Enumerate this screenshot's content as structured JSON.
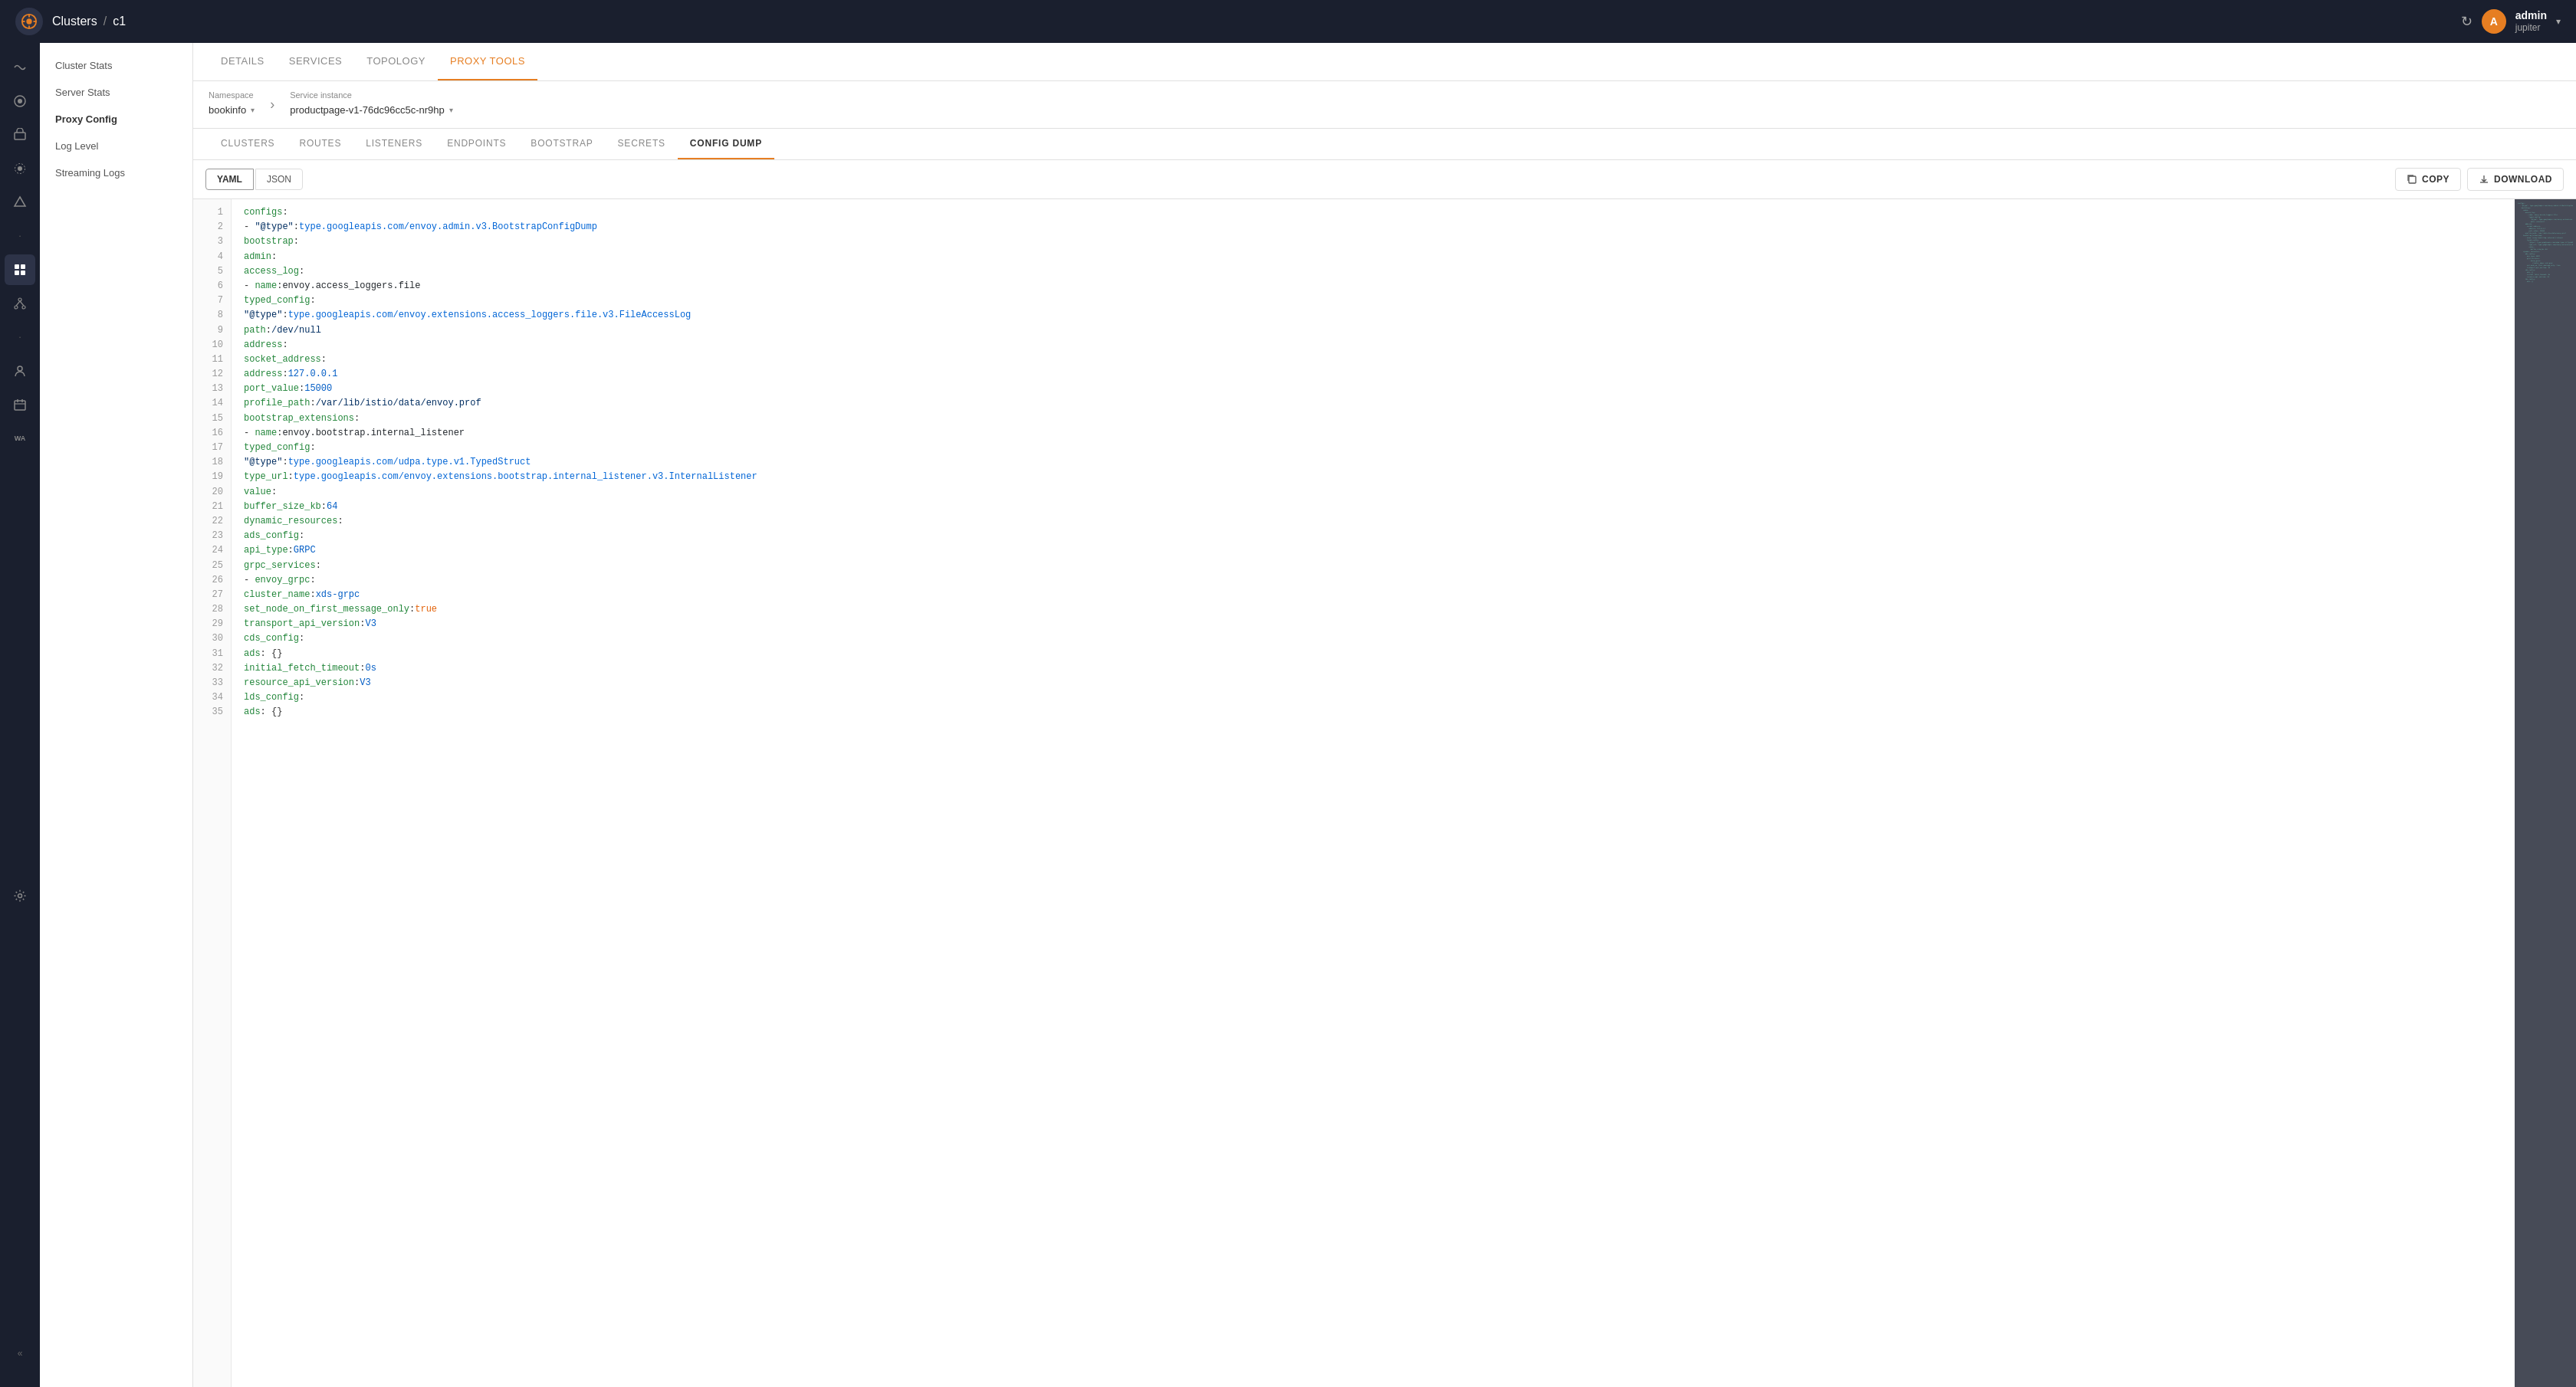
{
  "app": {
    "logo_alt": "Kiali",
    "breadcrumb": {
      "parent": "Clusters",
      "separator": "/",
      "current": "c1"
    }
  },
  "user": {
    "initial": "A",
    "name": "admin",
    "org": "jupiter"
  },
  "top_tabs": [
    {
      "id": "details",
      "label": "DETAILS"
    },
    {
      "id": "services",
      "label": "SERVICES"
    },
    {
      "id": "topology",
      "label": "TOPOLOGY"
    },
    {
      "id": "proxy-tools",
      "label": "PROXY TOOLS",
      "active": true
    }
  ],
  "namespace": {
    "label": "Namespace",
    "value": "bookinfo"
  },
  "service_instance": {
    "label": "Service instance",
    "value": "productpage-v1-76dc96cc5c-nr9hp"
  },
  "proxy_tabs": [
    {
      "id": "clusters",
      "label": "CLUSTERS"
    },
    {
      "id": "routes",
      "label": "ROUTES"
    },
    {
      "id": "listeners",
      "label": "LISTENERS"
    },
    {
      "id": "endpoints",
      "label": "ENDPOINTS"
    },
    {
      "id": "bootstrap",
      "label": "BOOTSTRAP"
    },
    {
      "id": "secrets",
      "label": "SECRETS"
    },
    {
      "id": "config-dump",
      "label": "CONFIG DUMP",
      "active": true
    }
  ],
  "sidebar_items": [
    {
      "id": "cluster-stats",
      "label": "Cluster Stats"
    },
    {
      "id": "server-stats",
      "label": "Server Stats"
    },
    {
      "id": "proxy-config",
      "label": "Proxy Config",
      "active": true
    },
    {
      "id": "log-level",
      "label": "Log Level"
    },
    {
      "id": "streaming-logs",
      "label": "Streaming Logs"
    }
  ],
  "format_tabs": [
    {
      "id": "yaml",
      "label": "YAML",
      "active": true
    },
    {
      "id": "json",
      "label": "JSON"
    }
  ],
  "actions": {
    "copy": "COPY",
    "download": "DOWNLOAD"
  },
  "code_lines": [
    {
      "num": 1,
      "text": "configs:"
    },
    {
      "num": 2,
      "text": "  - \"@type\": type.googleapis.com/envoy.admin.v3.BootstrapConfigDump"
    },
    {
      "num": 3,
      "text": "    bootstrap:"
    },
    {
      "num": 4,
      "text": "      admin:"
    },
    {
      "num": 5,
      "text": "        access_log:"
    },
    {
      "num": 6,
      "text": "          - name: envoy.access_loggers.file"
    },
    {
      "num": 7,
      "text": "            typed_config:"
    },
    {
      "num": 8,
      "text": "              \"@type\": type.googleapis.com/envoy.extensions.access_loggers.file.v3.FileAccessLog"
    },
    {
      "num": 9,
      "text": "              path: /dev/null"
    },
    {
      "num": 10,
      "text": "        address:"
    },
    {
      "num": 11,
      "text": "          socket_address:"
    },
    {
      "num": 12,
      "text": "            address: 127.0.0.1"
    },
    {
      "num": 13,
      "text": "            port_value: 15000"
    },
    {
      "num": 14,
      "text": "        profile_path: /var/lib/istio/data/envoy.prof"
    },
    {
      "num": 15,
      "text": "      bootstrap_extensions:"
    },
    {
      "num": 16,
      "text": "        - name: envoy.bootstrap.internal_listener"
    },
    {
      "num": 17,
      "text": "          typed_config:"
    },
    {
      "num": 18,
      "text": "            \"@type\": type.googleapis.com/udpa.type.v1.TypedStruct"
    },
    {
      "num": 19,
      "text": "            type_url: type.googleapis.com/envoy.extensions.bootstrap.internal_listener.v3.InternalListener"
    },
    {
      "num": 20,
      "text": "            value:"
    },
    {
      "num": 21,
      "text": "              buffer_size_kb: 64"
    },
    {
      "num": 22,
      "text": "      dynamic_resources:"
    },
    {
      "num": 23,
      "text": "        ads_config:"
    },
    {
      "num": 24,
      "text": "          api_type: GRPC"
    },
    {
      "num": 25,
      "text": "          grpc_services:"
    },
    {
      "num": 26,
      "text": "            - envoy_grpc:"
    },
    {
      "num": 27,
      "text": "                cluster_name: xds-grpc"
    },
    {
      "num": 28,
      "text": "          set_node_on_first_message_only: true"
    },
    {
      "num": 29,
      "text": "          transport_api_version: V3"
    },
    {
      "num": 30,
      "text": "        cds_config:"
    },
    {
      "num": 31,
      "text": "          ads: {}"
    },
    {
      "num": 32,
      "text": "          initial_fetch_timeout: 0s"
    },
    {
      "num": 33,
      "text": "          resource_api_version: V3"
    },
    {
      "num": 34,
      "text": "        lds_config:"
    },
    {
      "num": 35,
      "text": "          ads: {}"
    }
  ],
  "sidebar_icons": [
    {
      "id": "graph",
      "icon": "~",
      "active": false
    },
    {
      "id": "overview",
      "icon": "◉",
      "active": false
    },
    {
      "id": "workloads",
      "icon": "⬡",
      "active": false
    },
    {
      "id": "services",
      "icon": "⚙",
      "active": false
    },
    {
      "id": "istio",
      "icon": "⬡",
      "active": false
    },
    {
      "id": "dot1",
      "icon": "•",
      "dot": true
    },
    {
      "id": "dashboard",
      "icon": "▦",
      "active": true
    },
    {
      "id": "network",
      "icon": "⊞",
      "active": false
    },
    {
      "id": "dot2",
      "icon": "•",
      "dot": true
    },
    {
      "id": "profiles",
      "icon": "👤",
      "active": false
    },
    {
      "id": "calendar",
      "icon": "📅",
      "active": false
    },
    {
      "id": "wasm",
      "icon": "WA",
      "active": false
    },
    {
      "id": "settings",
      "icon": "⚙",
      "active": false
    }
  ]
}
